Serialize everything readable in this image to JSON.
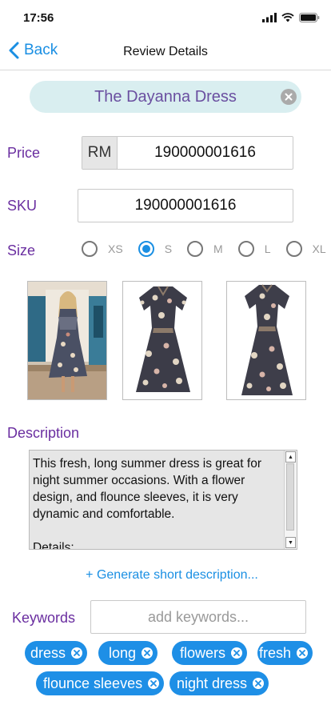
{
  "status": {
    "time": "17:56"
  },
  "nav": {
    "back_label": "Back",
    "title": "Review Details"
  },
  "product": {
    "name": "The Dayanna Dress"
  },
  "price": {
    "label": "Price",
    "currency": "RM",
    "value": "190000001616"
  },
  "sku": {
    "label": "SKU",
    "value": "190000001616"
  },
  "size": {
    "label": "Size",
    "options": [
      "XS",
      "S",
      "M",
      "L",
      "XL"
    ],
    "selected": "S"
  },
  "images": [
    {
      "name": "model-photo",
      "description": "woman wearing floral dress"
    },
    {
      "name": "dress-front-photo",
      "description": "floral dress front"
    },
    {
      "name": "dress-back-photo",
      "description": "floral dress back"
    }
  ],
  "description": {
    "label": "Description",
    "text": "This fresh, long summer dress is great for night summer occasions. With a flower design, and flounce sleeves, it is very dynamic and comfortable.\n\nDetails:"
  },
  "generate_link": "+ Generate short description...",
  "keywords": {
    "label": "Keywords",
    "placeholder": "add keywords...",
    "chips": [
      "dress",
      "long",
      "flowers",
      "fresh",
      "flounce sleeves",
      "night dress"
    ]
  },
  "colors": {
    "accent": "#1a8fe3",
    "label": "#6a2ea0",
    "chip": "#1e8fe6",
    "pill": "#d9eef0"
  }
}
